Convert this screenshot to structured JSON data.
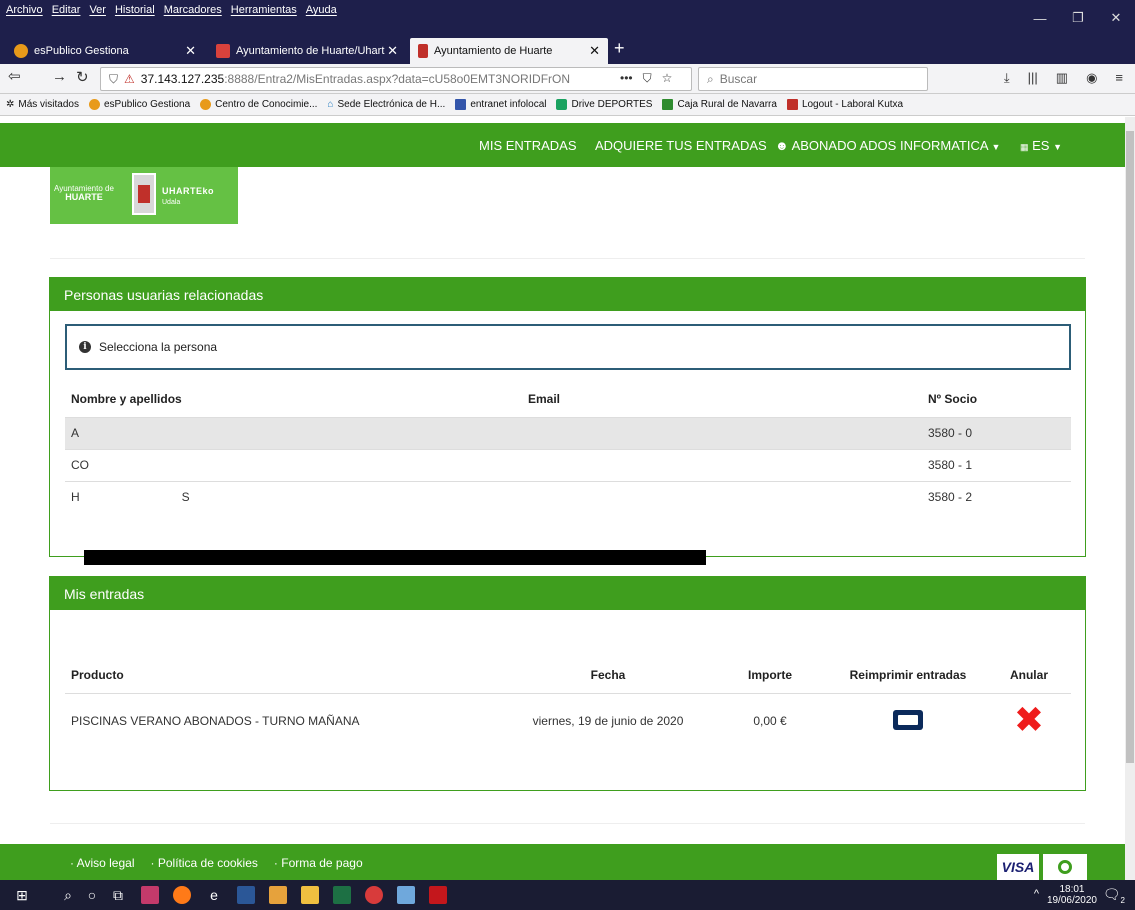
{
  "browser": {
    "menu": [
      "Archivo",
      "Editar",
      "Ver",
      "Historial",
      "Marcadores",
      "Herramientas",
      "Ayuda"
    ],
    "tabs": [
      {
        "title": "esPublico Gestiona",
        "color": "#e89a1a"
      },
      {
        "title": "Ayuntamiento de Huarte/Uhart",
        "color": "#d9423c"
      },
      {
        "title": "Ayuntamiento de Huarte",
        "color": "#c0302a"
      }
    ],
    "url_host": "37.143.127.235",
    "url_path": ":8888/Entra2/MisEntradas.aspx?data=cU58o0EMT3NORIDFrON",
    "search_placeholder": "Buscar",
    "bookmarks": [
      {
        "label": "Más visitados",
        "color": "#666666"
      },
      {
        "label": "esPublico Gestiona",
        "color": "#e89a1a"
      },
      {
        "label": "Centro de Conocimie...",
        "color": "#e89a1a"
      },
      {
        "label": "Sede Electrónica de H...",
        "color": "#2a7fc1"
      },
      {
        "label": "entranet infolocal",
        "color": "#3355aa"
      },
      {
        "label": "Drive DEPORTES",
        "color": "#1aa260"
      },
      {
        "label": "Caja Rural de Navarra",
        "color": "#2f8b2f"
      },
      {
        "label": "Logout - Laboral Kutxa",
        "color": "#c0302a"
      }
    ]
  },
  "nav": {
    "mis_entradas": "MIS ENTRADAS",
    "adquiere": "ADQUIERE TUS ENTRADAS",
    "user": "ABONADO ADOS INFORMATICA",
    "lang": "ES"
  },
  "logo": {
    "line1": "Ayuntamiento de",
    "line1b": "HUARTE",
    "line2": "UHARTEko",
    "line2b": "Udala"
  },
  "usuarios": {
    "title": "Personas usuarias relacionadas",
    "info": "Selecciona la persona",
    "headers": {
      "nombre": "Nombre y apellidos",
      "email": "Email",
      "socio": "Nº Socio"
    },
    "rows": [
      {
        "nombre": "A",
        "email": "",
        "socio": "3580 - 0"
      },
      {
        "nombre": "CO",
        "email": "",
        "socio": "3580 - 1"
      },
      {
        "nombre": "H",
        "email": "",
        "socio": "3580 - 2"
      }
    ],
    "row3_tail": "S"
  },
  "entradas": {
    "title": "Mis entradas",
    "headers": {
      "producto": "Producto",
      "fecha": "Fecha",
      "importe": "Importe",
      "reimprimir": "Reimprimir entradas",
      "anular": "Anular"
    },
    "rows": [
      {
        "producto": "PISCINAS VERANO ABONADOS - TURNO MAÑANA",
        "fecha": "viernes, 19 de junio de 2020",
        "importe": "0,00 €"
      }
    ]
  },
  "footer": {
    "links": [
      "Aviso legal",
      "Política de cookies",
      "Forma de pago"
    ],
    "visa": "VISA"
  },
  "taskbar": {
    "time": "18:01",
    "date": "19/06/2020",
    "notifications": "2"
  },
  "colors": {
    "brand_green": "#3f9e1e",
    "logo_green": "#65c144",
    "info_border": "#2c5d77",
    "cancel_red": "#ef1c1c",
    "ticket_navy": "#0b2a5b"
  }
}
